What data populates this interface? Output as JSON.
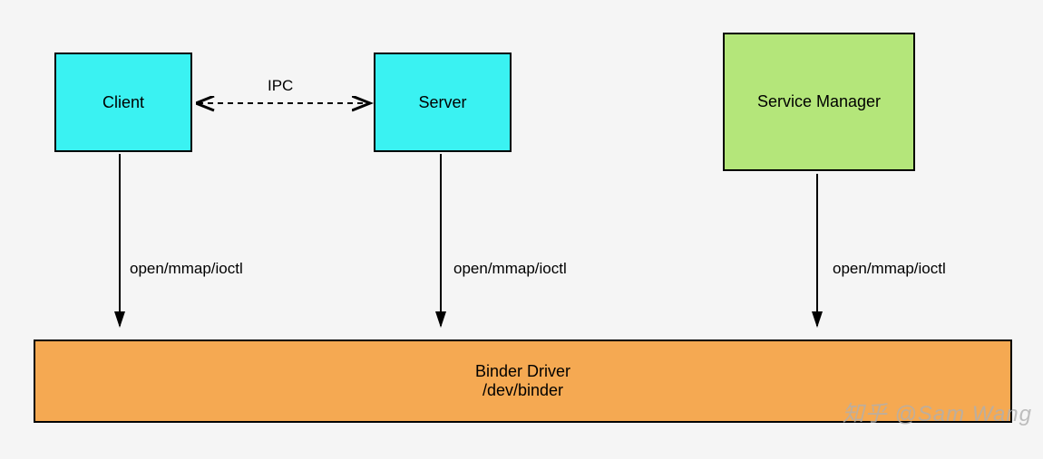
{
  "nodes": {
    "client": "Client",
    "server": "Server",
    "service_manager": "Service Manager",
    "driver_line1": "Binder Driver",
    "driver_line2": "/dev/binder"
  },
  "edges": {
    "ipc_label": "IPC",
    "syscall_client": "open/mmap/ioctl",
    "syscall_server": "open/mmap/ioctl",
    "syscall_svcmgr": "open/mmap/ioctl"
  },
  "watermark": "知乎 @Sam Wang"
}
